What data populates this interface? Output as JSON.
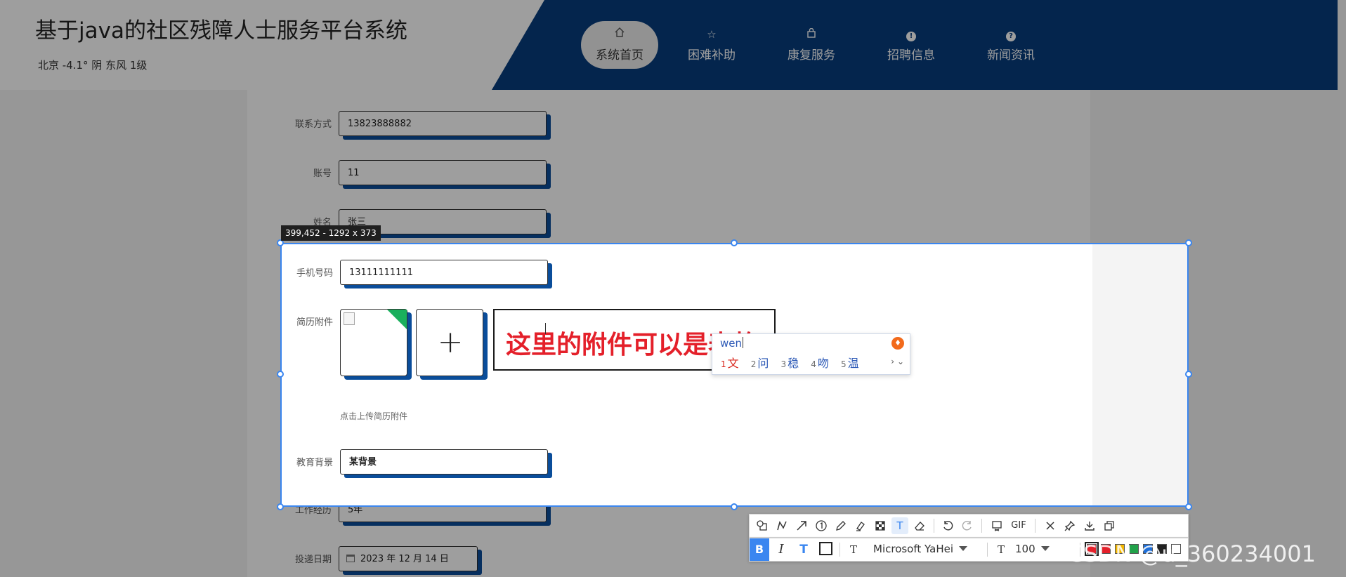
{
  "header": {
    "site_title": "基于java的社区残障人士服务平台系统",
    "weather": "北京  -4.1°  阴  东风  1级",
    "nav": [
      {
        "label": "系统首页",
        "icon": "home-icon",
        "active": true
      },
      {
        "label": "困难补助",
        "icon": "star-icon"
      },
      {
        "label": "康复服务",
        "icon": "bag-icon"
      },
      {
        "label": "招聘信息",
        "icon": "info-circle-icon"
      },
      {
        "label": "新闻资讯",
        "icon": "question-circle-icon"
      }
    ]
  },
  "form": {
    "contact": {
      "label": "联系方式",
      "value": "13823888882"
    },
    "account": {
      "label": "账号",
      "value": "11"
    },
    "name": {
      "label": "姓名",
      "value": "张三"
    },
    "mobile": {
      "label": "手机号码",
      "value": "13111111111"
    },
    "resume": {
      "label": "简历附件",
      "hint": "点击上传简历附件",
      "plus": "+"
    },
    "education": {
      "label": "教育背景",
      "value": "某背景"
    },
    "experience": {
      "label": "工作经历",
      "value": "5年"
    },
    "date": {
      "label": "投递日期",
      "value": "2023 年 12 月 14 日"
    }
  },
  "annotation": {
    "text": "这里的附件可以是表格"
  },
  "screenshot_tool": {
    "dimensions": "399,452 - 1292 x 373",
    "ime": {
      "input": "wen",
      "candidates": [
        {
          "num": "1",
          "text": "文"
        },
        {
          "num": "2",
          "text": "问"
        },
        {
          "num": "3",
          "text": "稳"
        },
        {
          "num": "4",
          "text": "吻"
        },
        {
          "num": "5",
          "text": "温"
        }
      ]
    },
    "toolbar_top": {
      "gif": "GIF"
    },
    "toolbar_bottom": {
      "bold": "B",
      "italic": "I",
      "textbg": "T",
      "font_family": "Microsoft YaHei",
      "font_size": "100"
    },
    "colors": [
      "#e4202a",
      "#e4202a",
      "#f2b600",
      "#22a24a",
      "#1e6fd9",
      "#222222",
      "#ffffff"
    ]
  },
  "watermark": {
    "text": "CSDN @u_360234001"
  },
  "theme": {
    "nav_blue": "#073c7c",
    "accent": "#3a86f0",
    "annotation_red": "#e4202a"
  }
}
